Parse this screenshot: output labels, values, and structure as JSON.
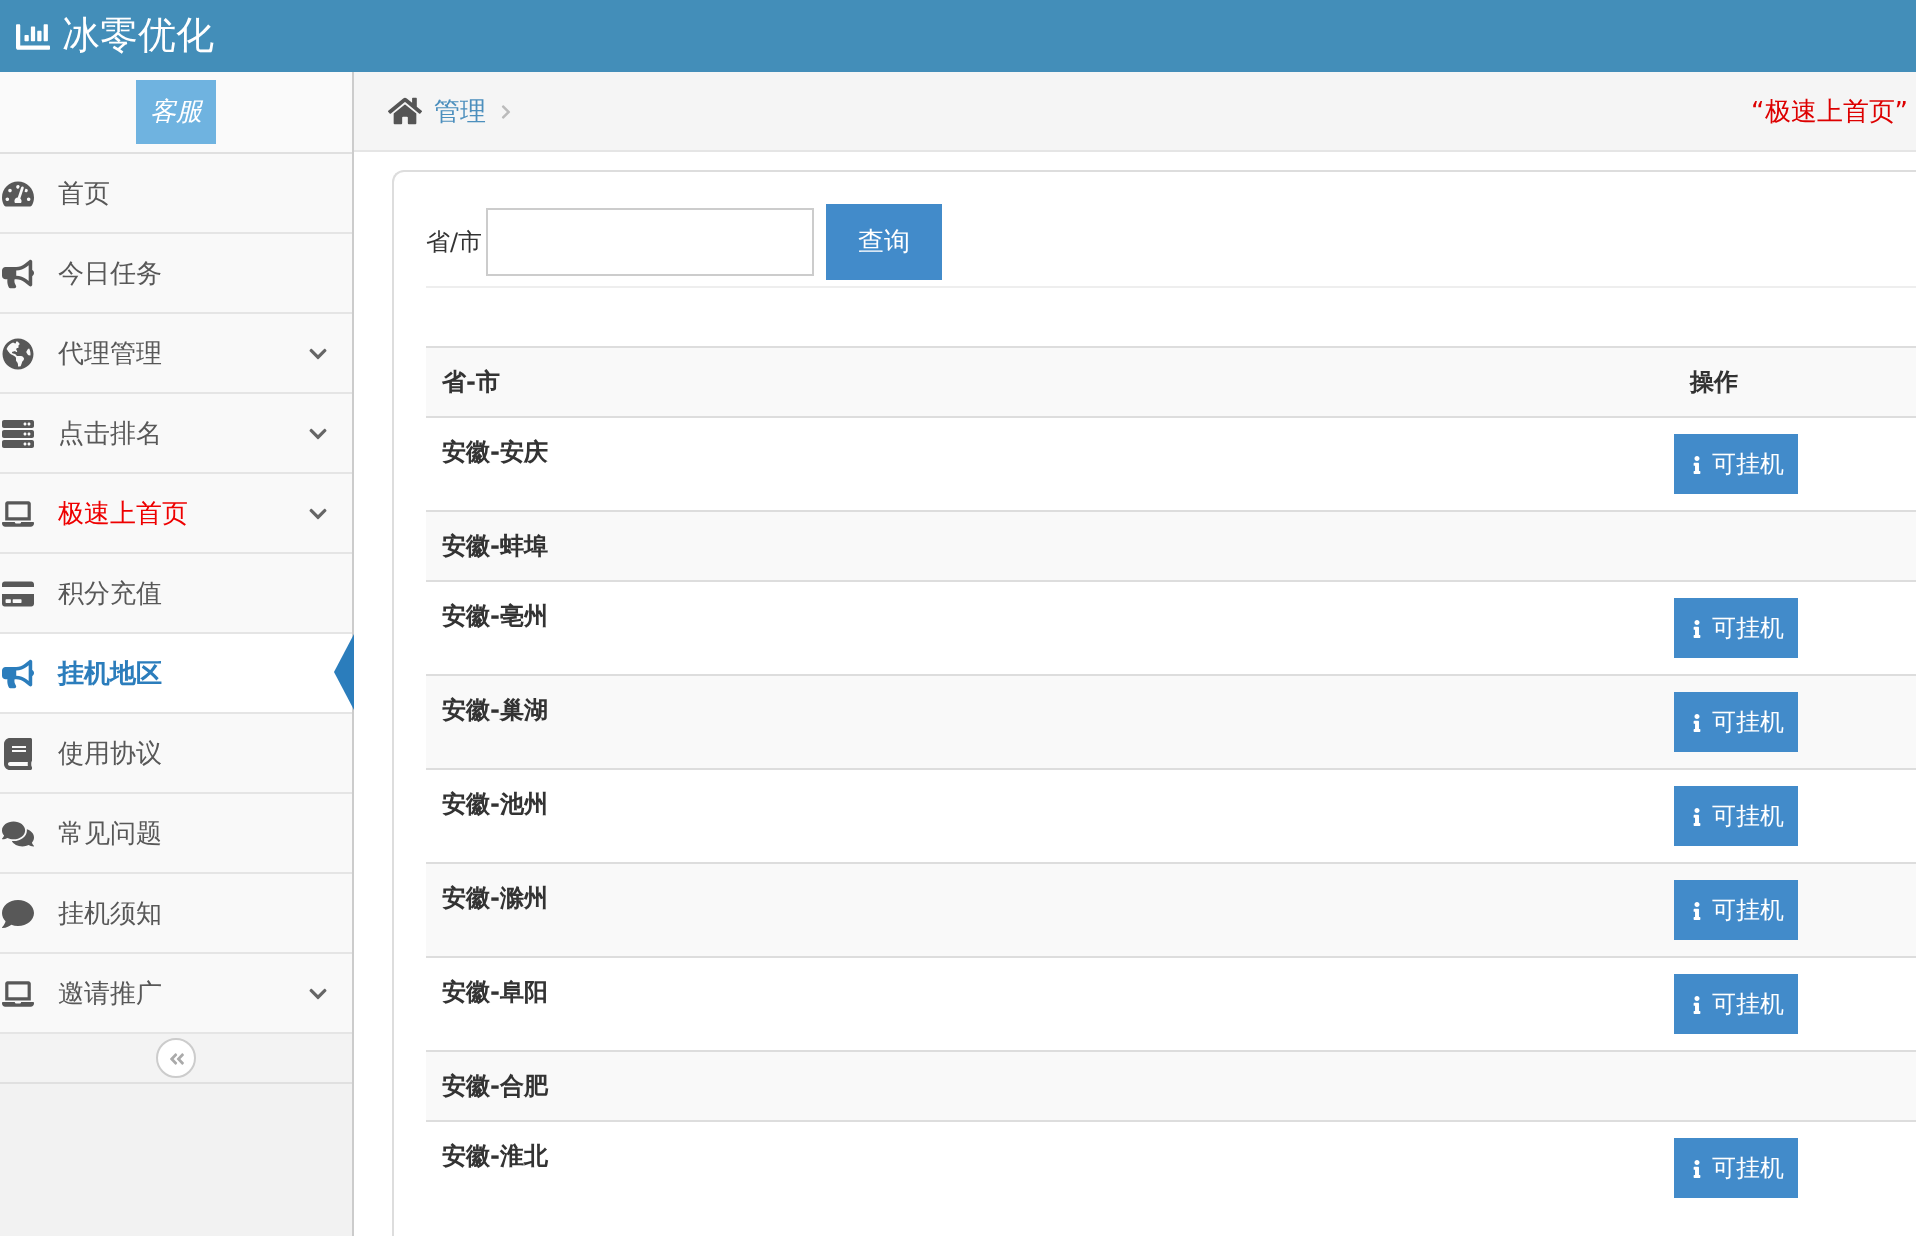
{
  "header": {
    "title": "冰零优化"
  },
  "sidebar": {
    "service_button": "客服",
    "items": [
      {
        "label": "首页",
        "selected": false,
        "highlight": false,
        "has_children": false
      },
      {
        "label": "今日任务",
        "selected": false,
        "highlight": false,
        "has_children": false
      },
      {
        "label": "代理管理",
        "selected": false,
        "highlight": false,
        "has_children": true
      },
      {
        "label": "点击排名",
        "selected": false,
        "highlight": false,
        "has_children": true
      },
      {
        "label": "极速上首页",
        "selected": false,
        "highlight": true,
        "has_children": true
      },
      {
        "label": "积分充值",
        "selected": false,
        "highlight": false,
        "has_children": false
      },
      {
        "label": "挂机地区",
        "selected": true,
        "highlight": false,
        "has_children": false
      },
      {
        "label": "使用协议",
        "selected": false,
        "highlight": false,
        "has_children": false
      },
      {
        "label": "常见问题",
        "selected": false,
        "highlight": false,
        "has_children": false
      },
      {
        "label": "挂机须知",
        "selected": false,
        "highlight": false,
        "has_children": false
      },
      {
        "label": "邀请推广",
        "selected": false,
        "highlight": false,
        "has_children": true
      }
    ]
  },
  "breadcrumb": {
    "items": [
      "管理"
    ],
    "notice": "“极速上首页”"
  },
  "search": {
    "label": "省/市",
    "button": "查询"
  },
  "table": {
    "columns": [
      "省-市",
      "操作"
    ],
    "rows": [
      {
        "place": "安徽-安庆",
        "action": "可挂机"
      },
      {
        "place": "安徽-蚌埠"
      },
      {
        "place": "安徽-亳州",
        "action": "可挂机"
      },
      {
        "place": "安徽-巢湖",
        "action": "可挂机"
      },
      {
        "place": "安徽-池州",
        "action": "可挂机"
      },
      {
        "place": "安徽-滁州",
        "action": "可挂机"
      },
      {
        "place": "安徽-阜阳",
        "action": "可挂机"
      },
      {
        "place": "安徽-合肥"
      },
      {
        "place": "安徽-淮北",
        "action": "可挂机"
      }
    ]
  }
}
